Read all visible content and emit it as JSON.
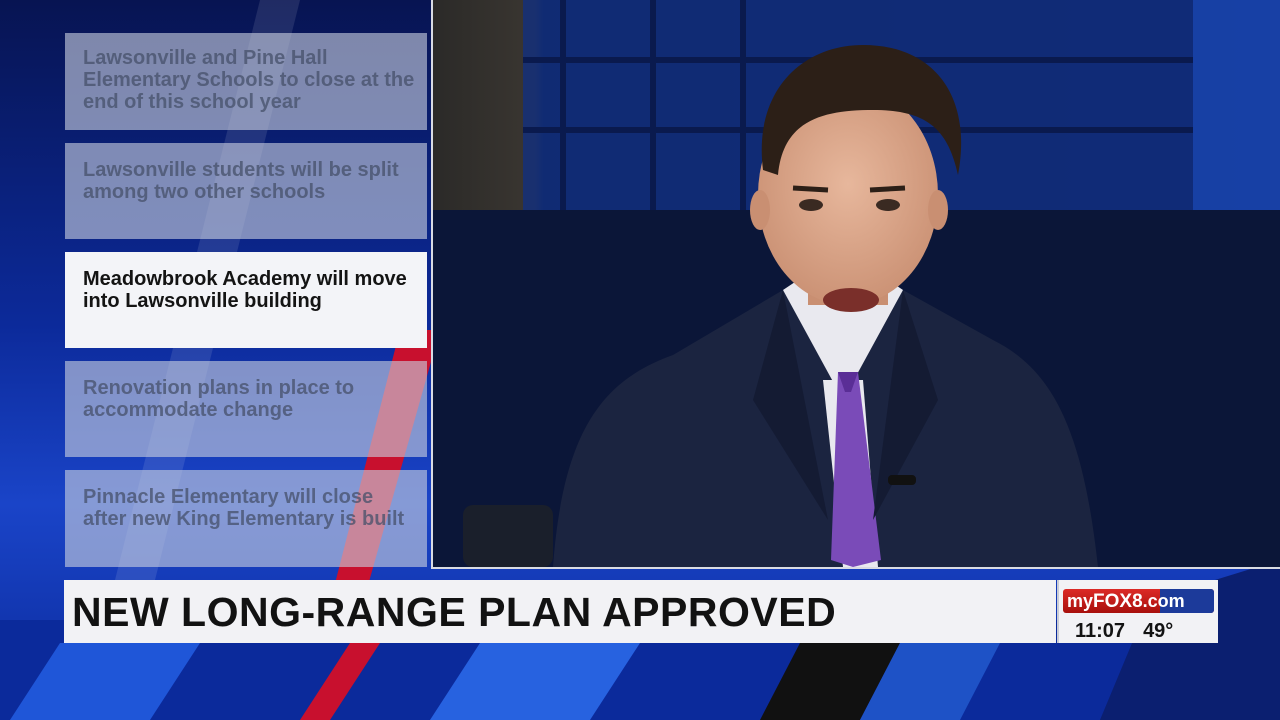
{
  "bullets": [
    {
      "text": "Lawsonville and Pine Hall Elementary Schools to close at the end of this school year",
      "active": false
    },
    {
      "text": "Lawsonville students will be split among two other schools",
      "active": false
    },
    {
      "text": "Meadowbrook Academy will move into Lawsonville building",
      "active": true
    },
    {
      "text": "Renovation plans in place to accommodate change",
      "active": false
    },
    {
      "text": "Pinnacle Elementary will close after new King Elementary is built",
      "active": false
    }
  ],
  "lower_third": {
    "headline": "NEW LONG-RANGE PLAN APPROVED"
  },
  "station": {
    "logo_my": "my",
    "logo_fox8": "FOX8",
    "logo_dotcom": ".com",
    "time": "11:07",
    "temperature": "49°"
  },
  "colors": {
    "background_blue": "#0c2a9a",
    "accent_red": "#c8102e",
    "card_active": "#f3f4f8",
    "card_inactive": "#c8cede"
  }
}
